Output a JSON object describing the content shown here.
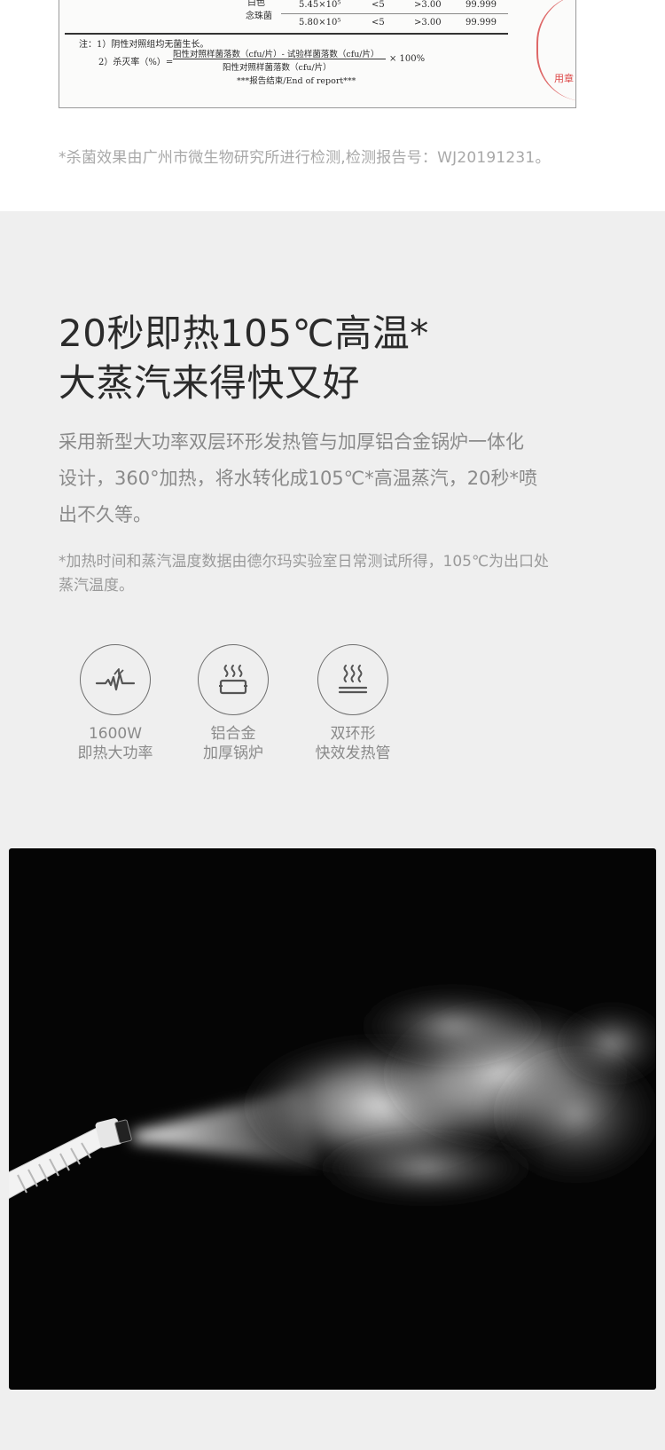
{
  "report": {
    "table_rows": [
      {
        "organism": "白色",
        "count": "",
        "low": "",
        "log": "",
        "rate": ""
      },
      {
        "organism": "念珠菌",
        "count": "5.45×10⁵",
        "low": "<5",
        "log": ">3.00",
        "rate": "99.999"
      },
      {
        "organism": "",
        "count": "5.80×10⁵",
        "low": "<5",
        "log": ">3.00",
        "rate": "99.999"
      }
    ],
    "note1": "注：1）阴性对照组均无菌生长。",
    "note2_prefix": "2）杀灭率（%）=",
    "note2_numerator": "阳性对照样菌落数（cfu/片）- 试验样菌落数（cfu/片）",
    "note2_denominator": "阳性对照样菌落数（cfu/片）",
    "note2_suffix": "× 100%",
    "end_text": "***报告结束/End of report***",
    "stamp_text": "用章",
    "caption": "*杀菌效果由广州市微生物研究所进行检测,检测报告号：WJ20191231。"
  },
  "feature": {
    "headline_line1": "20秒即热105℃高温*",
    "headline_line2": "大蒸汽来得快又好",
    "body_line1": "采用新型大功率双层环形发热管与加厚铝合金锅炉一体化",
    "body_line2": "设计，360°加热，将水转化成105℃*高温蒸汽，20秒*喷",
    "body_line3": "出不久等。",
    "footnote_line1": "*加热时间和蒸汽温度数据由德尔玛实验室日常测试所得，105℃为出口处",
    "footnote_line2": "蒸汽温度。",
    "icons": [
      {
        "icon": "power-pulse-icon",
        "line1": "1600W",
        "line2": "即热大功率"
      },
      {
        "icon": "boiler-steam-icon",
        "line1": "铝合金",
        "line2": "加厚锅炉"
      },
      {
        "icon": "heating-tube-icon",
        "line1": "双环形",
        "line2": "快效发热管"
      }
    ]
  },
  "colors": {
    "section_bg": "#efefef",
    "headline": "#2b2b2b",
    "body": "#8a8a8a",
    "photo_bg": "#050505"
  }
}
